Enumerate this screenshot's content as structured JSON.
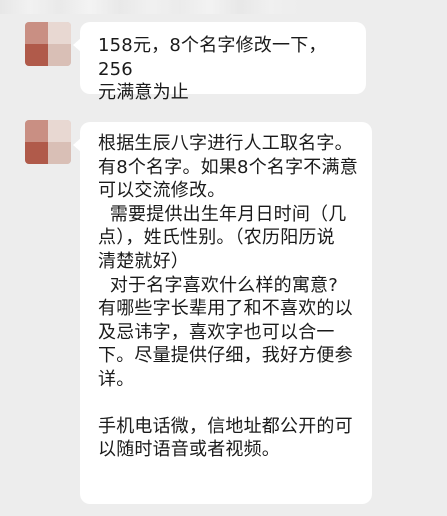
{
  "messages": [
    {
      "sender": "contact",
      "lines": [
        "158元，8个名字修改一下，256",
        "元满意为止"
      ]
    },
    {
      "sender": "contact",
      "lines": [
        "根据生辰八字进行人工取名字。",
        "有8个名字。如果8个名字不满意",
        "可以交流修改。",
        "  需要提供出生年月日时间（几",
        "点），姓氏性别。（农历阳历说",
        "清楚就好）",
        "  对于名字喜欢什么样的寓意?",
        "有哪些字长辈用了和不喜欢的以",
        "及忌讳字，喜欢字也可以合一",
        "下。尽量提供仔细，我好方便参",
        "详。",
        "",
        "手机电话微，信地址都公开的可",
        "以随时语音或者视频。"
      ]
    }
  ],
  "colors": {
    "background": "#ededed",
    "bubble": "#ffffff",
    "text": "#1a1a1a"
  }
}
